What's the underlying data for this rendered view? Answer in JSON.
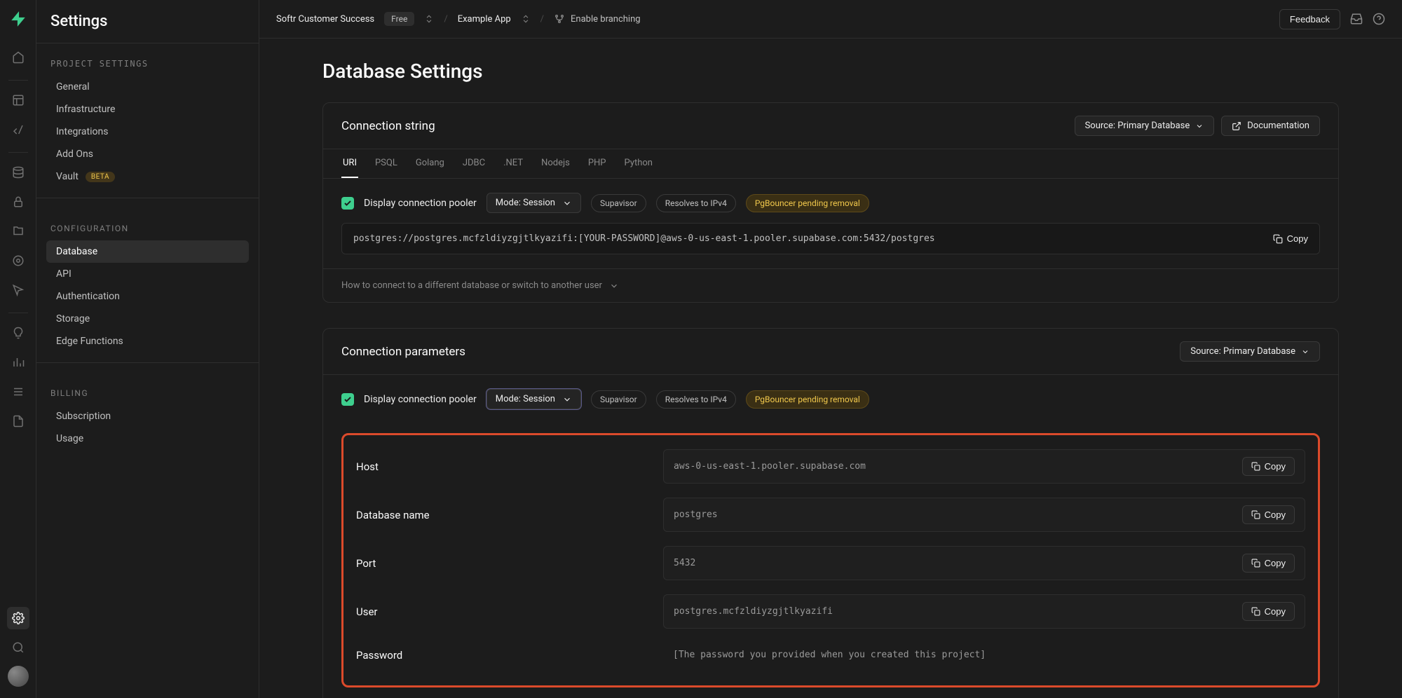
{
  "sidebar": {
    "title": "Settings",
    "sections": {
      "project": "PROJECT SETTINGS",
      "config": "CONFIGURATION",
      "billing": "BILLING"
    },
    "items": {
      "general": "General",
      "infrastructure": "Infrastructure",
      "integrations": "Integrations",
      "addons": "Add Ons",
      "vault": "Vault",
      "vault_badge": "BETA",
      "database": "Database",
      "api": "API",
      "authentication": "Authentication",
      "storage": "Storage",
      "edge": "Edge Functions",
      "subscription": "Subscription",
      "usage": "Usage"
    }
  },
  "topbar": {
    "org": "Softr Customer Success",
    "plan": "Free",
    "project": "Example App",
    "branching": "Enable branching",
    "feedback": "Feedback"
  },
  "page": {
    "title": "Database Settings"
  },
  "conn_string": {
    "title": "Connection string",
    "source": "Source: Primary Database",
    "docs": "Documentation",
    "tabs": [
      "URI",
      "PSQL",
      "Golang",
      "JDBC",
      ".NET",
      "Nodejs",
      "PHP",
      "Python"
    ],
    "pooler_label": "Display connection pooler",
    "mode": "Mode: Session",
    "chip1": "Supavisor",
    "chip2": "Resolves to IPv4",
    "chip3": "PgBouncer pending removal",
    "value": "postgres://postgres.mcfzldiyzgjtlkyazifi:[YOUR-PASSWORD]@aws-0-us-east-1.pooler.supabase.com:5432/postgres",
    "copy": "Copy",
    "expand_hint": "How to connect to a different database or switch to another user"
  },
  "conn_params": {
    "title": "Connection parameters",
    "source": "Source: Primary Database",
    "pooler_label": "Display connection pooler",
    "mode": "Mode: Session",
    "chip1": "Supavisor",
    "chip2": "Resolves to IPv4",
    "chip3": "PgBouncer pending removal",
    "rows": {
      "host_label": "Host",
      "host_value": "aws-0-us-east-1.pooler.supabase.com",
      "db_label": "Database name",
      "db_value": "postgres",
      "port_label": "Port",
      "port_value": "5432",
      "user_label": "User",
      "user_value": "postgres.mcfzldiyzgjtlkyazifi",
      "pw_label": "Password",
      "pw_value": "[The password you provided when you created this project]"
    },
    "copy": "Copy"
  }
}
